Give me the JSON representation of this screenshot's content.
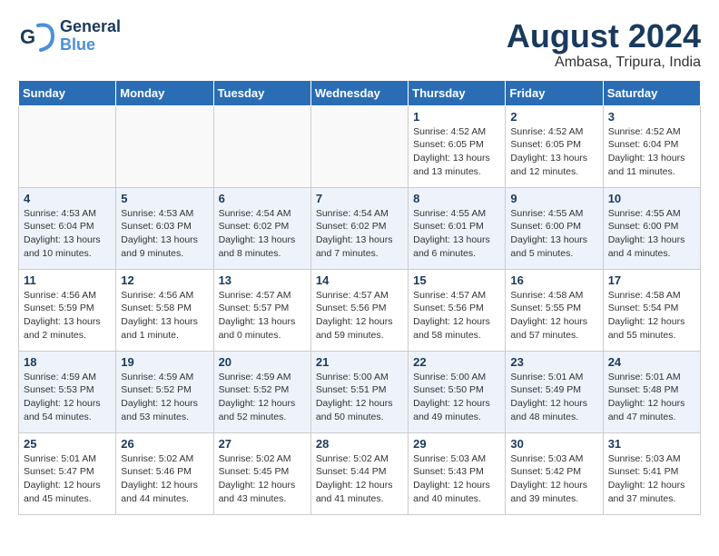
{
  "header": {
    "logo_line1": "General",
    "logo_line2": "Blue",
    "month": "August 2024",
    "location": "Ambasa, Tripura, India"
  },
  "weekdays": [
    "Sunday",
    "Monday",
    "Tuesday",
    "Wednesday",
    "Thursday",
    "Friday",
    "Saturday"
  ],
  "weeks": [
    [
      {
        "day": "",
        "info": ""
      },
      {
        "day": "",
        "info": ""
      },
      {
        "day": "",
        "info": ""
      },
      {
        "day": "",
        "info": ""
      },
      {
        "day": "1",
        "info": "Sunrise: 4:52 AM\nSunset: 6:05 PM\nDaylight: 13 hours\nand 13 minutes."
      },
      {
        "day": "2",
        "info": "Sunrise: 4:52 AM\nSunset: 6:05 PM\nDaylight: 13 hours\nand 12 minutes."
      },
      {
        "day": "3",
        "info": "Sunrise: 4:52 AM\nSunset: 6:04 PM\nDaylight: 13 hours\nand 11 minutes."
      }
    ],
    [
      {
        "day": "4",
        "info": "Sunrise: 4:53 AM\nSunset: 6:04 PM\nDaylight: 13 hours\nand 10 minutes."
      },
      {
        "day": "5",
        "info": "Sunrise: 4:53 AM\nSunset: 6:03 PM\nDaylight: 13 hours\nand 9 minutes."
      },
      {
        "day": "6",
        "info": "Sunrise: 4:54 AM\nSunset: 6:02 PM\nDaylight: 13 hours\nand 8 minutes."
      },
      {
        "day": "7",
        "info": "Sunrise: 4:54 AM\nSunset: 6:02 PM\nDaylight: 13 hours\nand 7 minutes."
      },
      {
        "day": "8",
        "info": "Sunrise: 4:55 AM\nSunset: 6:01 PM\nDaylight: 13 hours\nand 6 minutes."
      },
      {
        "day": "9",
        "info": "Sunrise: 4:55 AM\nSunset: 6:00 PM\nDaylight: 13 hours\nand 5 minutes."
      },
      {
        "day": "10",
        "info": "Sunrise: 4:55 AM\nSunset: 6:00 PM\nDaylight: 13 hours\nand 4 minutes."
      }
    ],
    [
      {
        "day": "11",
        "info": "Sunrise: 4:56 AM\nSunset: 5:59 PM\nDaylight: 13 hours\nand 2 minutes."
      },
      {
        "day": "12",
        "info": "Sunrise: 4:56 AM\nSunset: 5:58 PM\nDaylight: 13 hours\nand 1 minute."
      },
      {
        "day": "13",
        "info": "Sunrise: 4:57 AM\nSunset: 5:57 PM\nDaylight: 13 hours\nand 0 minutes."
      },
      {
        "day": "14",
        "info": "Sunrise: 4:57 AM\nSunset: 5:56 PM\nDaylight: 12 hours\nand 59 minutes."
      },
      {
        "day": "15",
        "info": "Sunrise: 4:57 AM\nSunset: 5:56 PM\nDaylight: 12 hours\nand 58 minutes."
      },
      {
        "day": "16",
        "info": "Sunrise: 4:58 AM\nSunset: 5:55 PM\nDaylight: 12 hours\nand 57 minutes."
      },
      {
        "day": "17",
        "info": "Sunrise: 4:58 AM\nSunset: 5:54 PM\nDaylight: 12 hours\nand 55 minutes."
      }
    ],
    [
      {
        "day": "18",
        "info": "Sunrise: 4:59 AM\nSunset: 5:53 PM\nDaylight: 12 hours\nand 54 minutes."
      },
      {
        "day": "19",
        "info": "Sunrise: 4:59 AM\nSunset: 5:52 PM\nDaylight: 12 hours\nand 53 minutes."
      },
      {
        "day": "20",
        "info": "Sunrise: 4:59 AM\nSunset: 5:52 PM\nDaylight: 12 hours\nand 52 minutes."
      },
      {
        "day": "21",
        "info": "Sunrise: 5:00 AM\nSunset: 5:51 PM\nDaylight: 12 hours\nand 50 minutes."
      },
      {
        "day": "22",
        "info": "Sunrise: 5:00 AM\nSunset: 5:50 PM\nDaylight: 12 hours\nand 49 minutes."
      },
      {
        "day": "23",
        "info": "Sunrise: 5:01 AM\nSunset: 5:49 PM\nDaylight: 12 hours\nand 48 minutes."
      },
      {
        "day": "24",
        "info": "Sunrise: 5:01 AM\nSunset: 5:48 PM\nDaylight: 12 hours\nand 47 minutes."
      }
    ],
    [
      {
        "day": "25",
        "info": "Sunrise: 5:01 AM\nSunset: 5:47 PM\nDaylight: 12 hours\nand 45 minutes."
      },
      {
        "day": "26",
        "info": "Sunrise: 5:02 AM\nSunset: 5:46 PM\nDaylight: 12 hours\nand 44 minutes."
      },
      {
        "day": "27",
        "info": "Sunrise: 5:02 AM\nSunset: 5:45 PM\nDaylight: 12 hours\nand 43 minutes."
      },
      {
        "day": "28",
        "info": "Sunrise: 5:02 AM\nSunset: 5:44 PM\nDaylight: 12 hours\nand 41 minutes."
      },
      {
        "day": "29",
        "info": "Sunrise: 5:03 AM\nSunset: 5:43 PM\nDaylight: 12 hours\nand 40 minutes."
      },
      {
        "day": "30",
        "info": "Sunrise: 5:03 AM\nSunset: 5:42 PM\nDaylight: 12 hours\nand 39 minutes."
      },
      {
        "day": "31",
        "info": "Sunrise: 5:03 AM\nSunset: 5:41 PM\nDaylight: 12 hours\nand 37 minutes."
      }
    ]
  ]
}
